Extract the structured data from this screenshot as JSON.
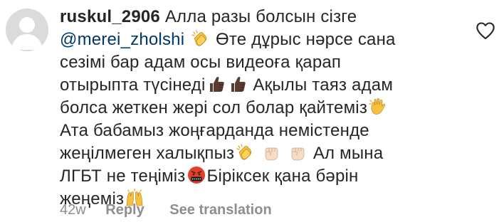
{
  "comment": {
    "username": "ruskul_2906",
    "lines": [
      {
        "segments": [
          {
            "type": "text",
            "text": " Алла разы болсын сізге"
          }
        ]
      },
      {
        "segments": [
          {
            "type": "mention",
            "text": "@merei_zholshi"
          },
          {
            "type": "text",
            "text": " "
          },
          {
            "type": "emoji",
            "icon": "clapping-hands-icon"
          },
          {
            "type": "text",
            "text": " Өте дұрыс нәрсе сана"
          }
        ]
      },
      {
        "segments": [
          {
            "type": "text",
            "text": "сезімі бар адам осы видеоға қарап"
          }
        ]
      },
      {
        "segments": [
          {
            "type": "text",
            "text": "отырыпта түсінеді"
          },
          {
            "type": "emoji",
            "icon": "thumbs-up-dark-icon"
          },
          {
            "type": "emoji",
            "icon": "thumbs-up-dark-icon"
          },
          {
            "type": "text",
            "text": " Ақылы таяз адам"
          }
        ]
      },
      {
        "segments": [
          {
            "type": "text",
            "text": "болса жеткен жері сол болар қайтеміз"
          },
          {
            "type": "emoji",
            "icon": "waving-hand-icon"
          }
        ]
      },
      {
        "segments": [
          {
            "type": "text",
            "text": "Ата бабамыз жоңғарданда немістенде"
          }
        ]
      },
      {
        "segments": [
          {
            "type": "text",
            "text": "жеңілмеген халықпыз"
          },
          {
            "type": "emoji",
            "icon": "clapping-hands-icon"
          },
          {
            "type": "text",
            "text": " "
          },
          {
            "type": "emoji",
            "icon": "raised-fist-icon"
          },
          {
            "type": "text",
            "text": " "
          },
          {
            "type": "emoji",
            "icon": "raised-fist-icon"
          },
          {
            "type": "text",
            "text": " Ал мына"
          }
        ]
      },
      {
        "segments": [
          {
            "type": "text",
            "text": "ЛГБТ не теңіміз"
          },
          {
            "type": "emoji",
            "icon": "cursing-face-icon"
          },
          {
            "type": "text",
            "text": "Біріксек қана бәрін"
          }
        ]
      },
      {
        "segments": [
          {
            "type": "text",
            "text": "жеңеміз"
          },
          {
            "type": "emoji",
            "icon": "raising-hands-icon"
          }
        ]
      }
    ],
    "meta": {
      "time": "42w",
      "reply_label": "Reply",
      "translation_label": "See translation"
    }
  },
  "colors": {
    "text": "#262626",
    "mention": "#00376b",
    "meta": "#8e8e8e",
    "avatar_bg": "#dbdbdb",
    "emoji_yellow": "#f7c23b",
    "emoji_dark_skin": "#5a3c2e",
    "emoji_light_skin": "#f6dcc5",
    "emoji_red": "#e0412e"
  }
}
